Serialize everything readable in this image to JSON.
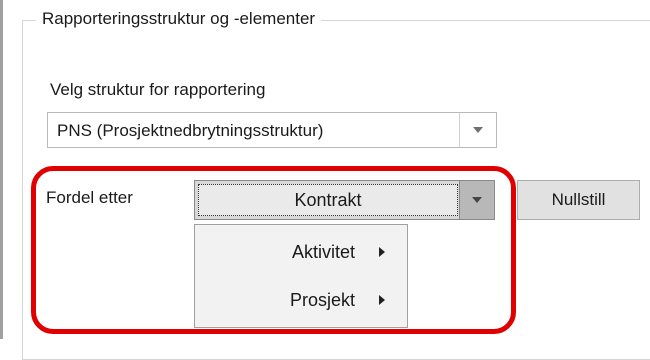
{
  "group": {
    "title": "Rapporteringsstruktur og -elementer"
  },
  "structure": {
    "label": "Velg struktur for rapportering",
    "selected": "PNS (Prosjektnedbrytningsstruktur)"
  },
  "distribute": {
    "label": "Fordel etter",
    "selected": "Kontrakt",
    "reset_label": "Nullstill",
    "menu": [
      {
        "label": "Aktivitet",
        "has_submenu": true
      },
      {
        "label": "Prosjekt",
        "has_submenu": true
      }
    ]
  },
  "colors": {
    "highlight": "#e00000"
  }
}
